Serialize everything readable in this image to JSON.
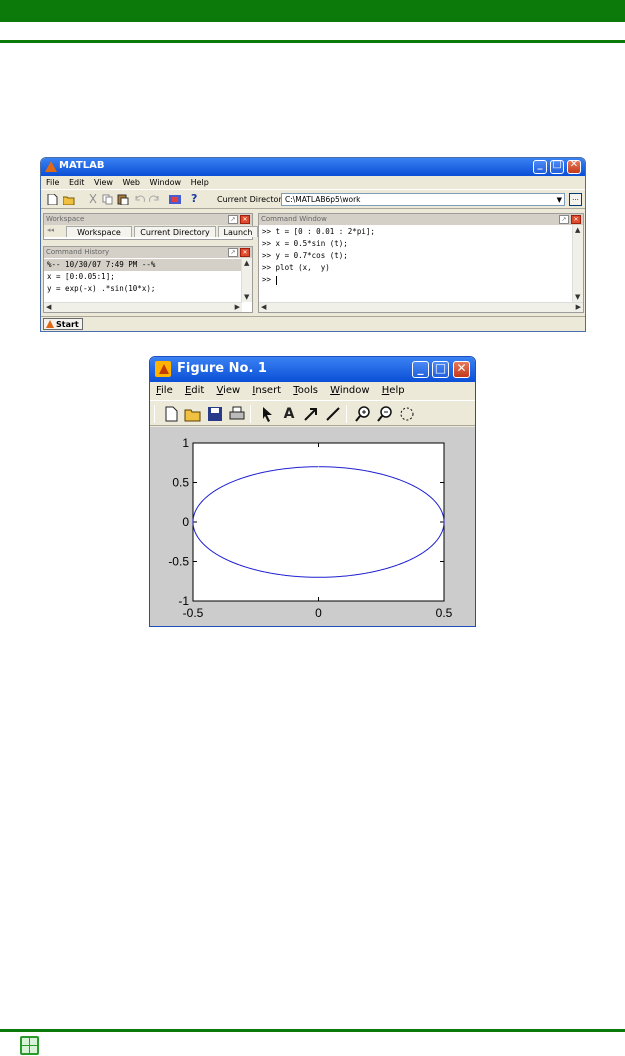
{
  "matlab": {
    "title": "MATLAB",
    "menu": [
      "File",
      "Edit",
      "View",
      "Web",
      "Window",
      "Help"
    ],
    "current_directory_label": "Current Directory:",
    "current_directory_value": "C:\\MATLAB6p5\\work",
    "browse_label": "...",
    "workspace": {
      "title": "Workspace",
      "tabs": [
        "Workspace",
        "Current Directory",
        "Launch"
      ]
    },
    "history": {
      "title": "Command History",
      "rows": [
        "%-- 10/30/07  7:49 PM --%",
        "x = [0:0.05:1];",
        "y = exp(-x) .*sin(10*x);"
      ]
    },
    "command_window": {
      "title": "Command Window",
      "lines": [
        ">> t = [0 : 0.01 : 2*pi];",
        ">> x = 0.5*sin (t);",
        ">> y = 0.7*cos (t);",
        ">> plot (x,  y)",
        ">> "
      ]
    },
    "start_label": "Start"
  },
  "figure": {
    "title": "Figure No. 1",
    "menu": [
      {
        "label": "File",
        "u": "F",
        "rest": "ile"
      },
      {
        "label": "Edit",
        "u": "E",
        "rest": "dit"
      },
      {
        "label": "View",
        "u": "V",
        "rest": "iew"
      },
      {
        "label": "Insert",
        "u": "I",
        "rest": "nsert"
      },
      {
        "label": "Tools",
        "u": "T",
        "rest": "ools"
      },
      {
        "label": "Window",
        "u": "W",
        "rest": "indow"
      },
      {
        "label": "Help",
        "u": "H",
        "rest": "elp"
      }
    ]
  },
  "colors": {
    "accent_green": "#0b7a0b",
    "curve": "#1f1fd0"
  },
  "chart_data": {
    "type": "line",
    "title": "",
    "xlabel": "",
    "ylabel": "",
    "xlim": [
      -0.5,
      0.5
    ],
    "ylim": [
      -1,
      1
    ],
    "xticks": [
      -0.5,
      0,
      0.5
    ],
    "xtick_labels": [
      "-0.5",
      "0",
      "0.5"
    ],
    "yticks": [
      -1,
      -0.5,
      0,
      0.5,
      1
    ],
    "ytick_labels": [
      "-1",
      "-0.5",
      "0",
      "0.5",
      "1"
    ],
    "grid": false,
    "series": [
      {
        "x_formula": "0.5*sin(t)",
        "y_formula": "0.7*cos(t)",
        "t_range": [
          0,
          6.28
        ],
        "t_step": 0.01
      }
    ]
  }
}
